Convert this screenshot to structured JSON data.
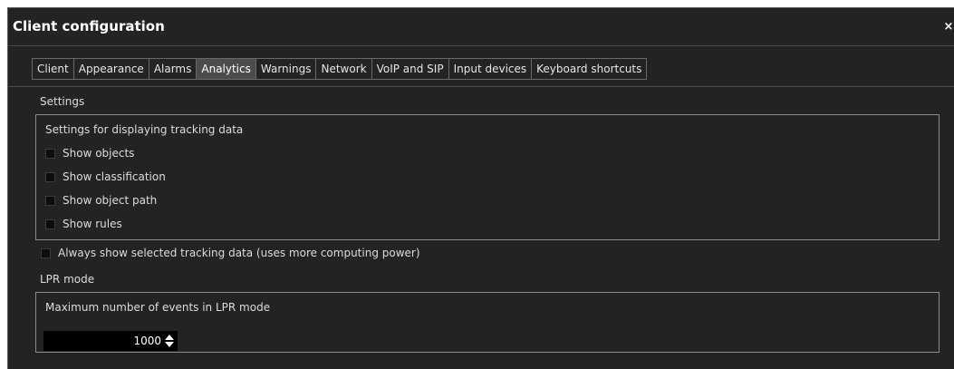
{
  "window": {
    "title": "Client configuration",
    "close_label": "×"
  },
  "tabs": [
    {
      "label": "Client",
      "active": false
    },
    {
      "label": "Appearance",
      "active": false
    },
    {
      "label": "Alarms",
      "active": false
    },
    {
      "label": "Analytics",
      "active": true
    },
    {
      "label": "Warnings",
      "active": false
    },
    {
      "label": "Network",
      "active": false
    },
    {
      "label": "VoIP and SIP",
      "active": false
    },
    {
      "label": "Input devices",
      "active": false
    },
    {
      "label": "Keyboard shortcuts",
      "active": false
    }
  ],
  "settings": {
    "section_label": "Settings",
    "group_label": "Settings for displaying tracking data",
    "checkboxes": [
      {
        "label": "Show objects",
        "checked": false
      },
      {
        "label": "Show classification",
        "checked": false
      },
      {
        "label": "Show object path",
        "checked": false
      },
      {
        "label": "Show rules",
        "checked": false
      }
    ],
    "always_show": {
      "label": "Always show selected tracking data (uses more computing power)",
      "checked": false
    }
  },
  "lpr": {
    "section_label": "LPR mode",
    "max_events_label": "Maximum number of events in LPR mode",
    "max_events_value": "1000"
  },
  "colors": {
    "background": "#232323",
    "active_tab": "#4c4c4c",
    "text": "#dcdcdc"
  }
}
